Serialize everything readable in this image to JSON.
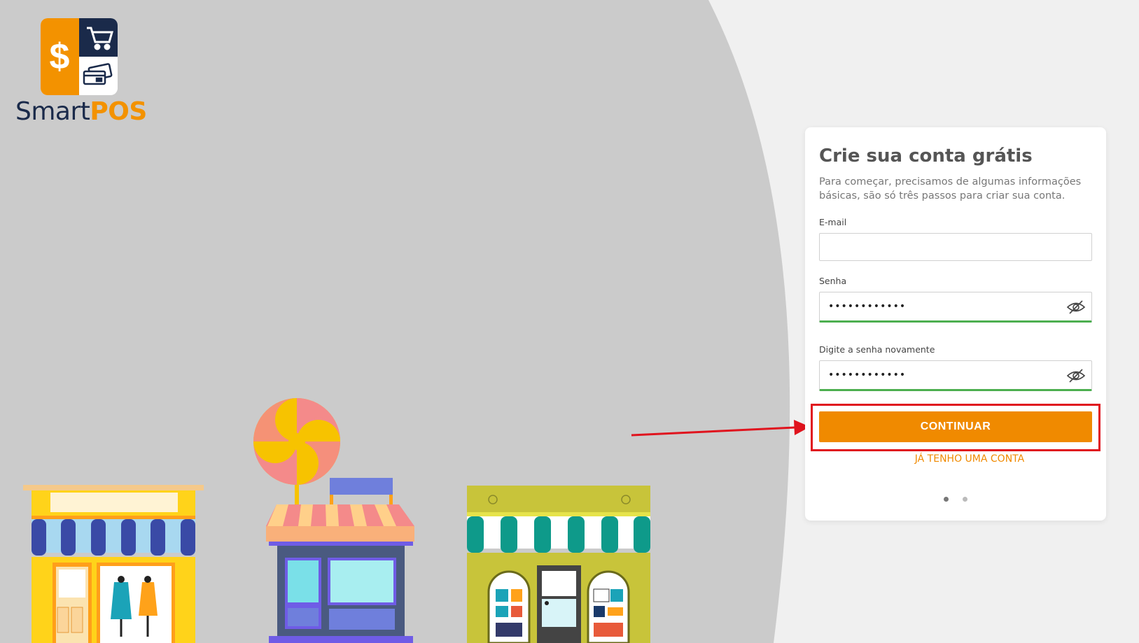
{
  "brand": {
    "name_part1": "Smart",
    "name_part2": "POS",
    "logo_icons": [
      "dollar-sign-icon",
      "shopping-cart-icon",
      "credit-cards-icon"
    ],
    "colors": {
      "orange": "#f39200",
      "navy": "#1a2a4a"
    }
  },
  "form": {
    "title": "Crie sua conta grátis",
    "subtitle": "Para começar, precisamos de algumas informações básicas, são só três passos para criar sua conta.",
    "email": {
      "label": "E-mail",
      "value": "",
      "placeholder": ""
    },
    "password": {
      "label": "Senha",
      "value": "abcdefghijkl",
      "icon": "eye-slash-icon"
    },
    "password_confirm": {
      "label": "Digite a senha novamente",
      "value": "abcdefghijkl",
      "icon": "eye-slash-icon"
    },
    "continue_label": "CONTINUAR",
    "login_link": "JÁ TENHO UMA CONTA",
    "steps": {
      "current": 1,
      "total": 2
    }
  },
  "annotation": {
    "highlight_color": "#e0141e",
    "target": "continue-button"
  },
  "colors": {
    "accent": "#f08a00",
    "valid": "#4caf50",
    "background": "#cccccc"
  }
}
